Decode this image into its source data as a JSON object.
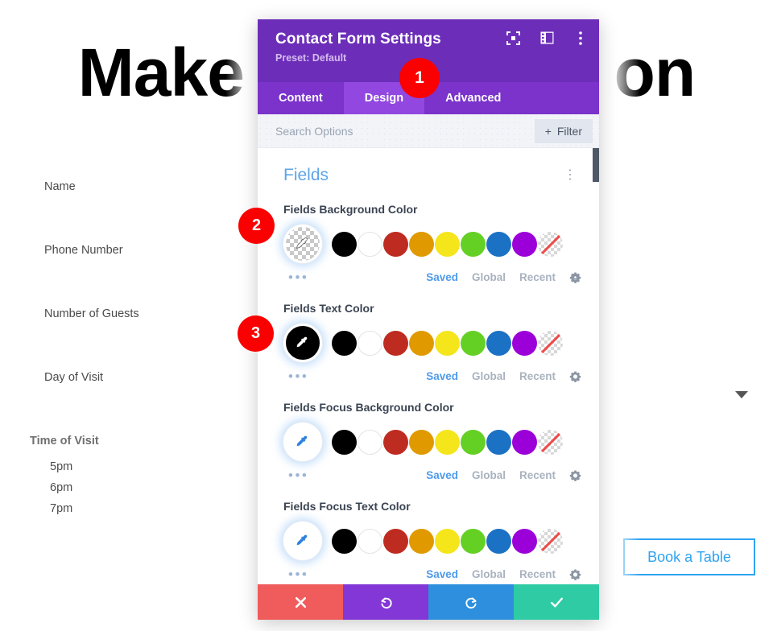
{
  "page": {
    "heading": "Make a Reservation",
    "form": {
      "labels": [
        {
          "text": "Name"
        },
        {
          "text": "Phone Number"
        },
        {
          "text": "Number of Guests"
        },
        {
          "text": "Day of Visit"
        }
      ],
      "time_label": "Time of Visit",
      "time_options": [
        "5pm",
        "6pm",
        "7pm"
      ],
      "submit_label": "Book a Table"
    }
  },
  "modal": {
    "title": "Contact Form Settings",
    "preset": "Preset: Default",
    "header_icons": [
      "focus-icon",
      "layout-panel-icon",
      "kebab-menu-icon"
    ],
    "tabs": [
      {
        "label": "Content",
        "active": false
      },
      {
        "label": "Design",
        "active": true
      },
      {
        "label": "Advanced",
        "active": false
      }
    ],
    "search": {
      "placeholder": "Search Options",
      "value": "",
      "filter_label": "Filter"
    },
    "section": {
      "title": "Fields",
      "kebab": "⋮"
    },
    "palette": {
      "colors": [
        {
          "name": "black",
          "hex": "#000000"
        },
        {
          "name": "white",
          "hex": "#FFFFFF"
        },
        {
          "name": "dark-red",
          "hex": "#BE2B20"
        },
        {
          "name": "orange",
          "hex": "#E09A00"
        },
        {
          "name": "yellow",
          "hex": "#F5E51B"
        },
        {
          "name": "green",
          "hex": "#64D024"
        },
        {
          "name": "blue",
          "hex": "#1B72C4"
        },
        {
          "name": "purple",
          "hex": "#9C00D9"
        },
        {
          "name": "transparent",
          "hex": "none"
        }
      ],
      "meta": {
        "saved": "Saved",
        "global": "Global",
        "recent": "Recent",
        "dots": "•••",
        "gear": "gear-icon"
      }
    },
    "fields": [
      {
        "label": "Fields Background Color",
        "swatch": "transparent-checker",
        "selected": true
      },
      {
        "label": "Fields Text Color",
        "swatch": "black",
        "selected": true
      },
      {
        "label": "Fields Focus Background Color",
        "swatch": "white",
        "selected": false
      },
      {
        "label": "Fields Focus Text Color",
        "swatch": "white",
        "selected": false
      }
    ],
    "footer": [
      {
        "name": "cancel",
        "icon": "✖",
        "color": "#F05B5B"
      },
      {
        "name": "undo",
        "icon": "↺",
        "color": "#8237D6"
      },
      {
        "name": "redo",
        "icon": "↻",
        "color": "#2D8FDD"
      },
      {
        "name": "save",
        "icon": "✔",
        "color": "#2ECBA4"
      }
    ]
  },
  "callouts": [
    {
      "number": "1"
    },
    {
      "number": "2"
    },
    {
      "number": "3"
    }
  ]
}
